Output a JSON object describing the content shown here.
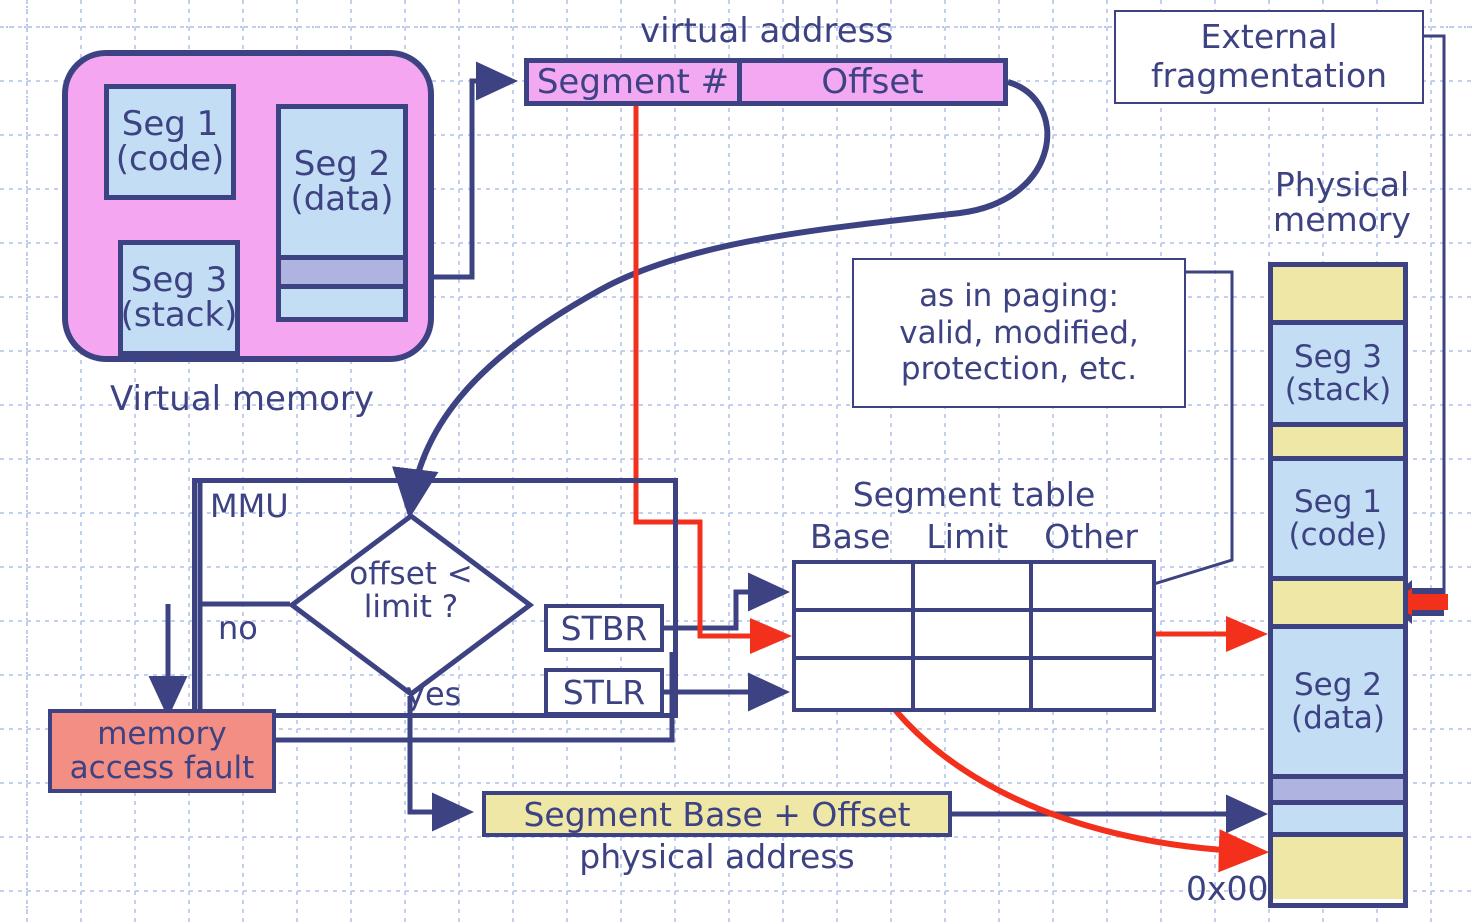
{
  "title": "Segmentation address translation diagram",
  "colors": {
    "ink": "#3d4282",
    "virtual_pod": "#f4a6f0",
    "segment_fill": "#c3ddf5",
    "virtual_address_fill": "#f3a8f2",
    "fault_fill": "#f38e84",
    "physical_address_fill": "#efe7a6",
    "free_hole_fill": "#efe7a6",
    "red_path": "#f3301c",
    "grid": "#c2cfee",
    "band_fill": "#aeb3e0"
  },
  "virtual_memory": {
    "caption": "Virtual memory",
    "segments": [
      {
        "name": "Seg 1",
        "kind": "(code)"
      },
      {
        "name": "Seg 2",
        "kind": "(data)"
      },
      {
        "name": "Seg 3",
        "kind": "(stack)"
      }
    ]
  },
  "virtual_address": {
    "caption": "virtual address",
    "fields": [
      {
        "label": "Segment #"
      },
      {
        "label": "Offset"
      }
    ]
  },
  "callouts": {
    "external_fragmentation": "External\nfragmentation",
    "as_in_paging": "as in paging:\nvalid, modified,\nprotection, etc."
  },
  "mmu": {
    "label": "MMU",
    "decision": "offset <\nlimit ?",
    "branch_no": "no",
    "branch_yes": "yes",
    "registers": [
      {
        "label": "STBR"
      },
      {
        "label": "STLR"
      }
    ]
  },
  "fault": {
    "label": "memory\naccess fault"
  },
  "physical_address": {
    "box_label": "Segment Base + Offset",
    "caption": "physical address"
  },
  "segment_table": {
    "title": "Segment table",
    "columns": [
      "Base",
      "Limit",
      "Other"
    ],
    "rows": [
      [
        "",
        "",
        ""
      ],
      [
        "",
        "",
        ""
      ],
      [
        "",
        "",
        ""
      ]
    ]
  },
  "physical_memory": {
    "caption": "Physical\nmemory",
    "base_label": "0x00",
    "blocks": [
      {
        "type": "hole",
        "label": "",
        "sub": ""
      },
      {
        "type": "segment",
        "label": "Seg 3",
        "sub": "(stack)"
      },
      {
        "type": "hole",
        "label": "",
        "sub": ""
      },
      {
        "type": "segment",
        "label": "Seg 1",
        "sub": "(code)"
      },
      {
        "type": "hole",
        "label": "",
        "sub": ""
      },
      {
        "type": "segment",
        "label": "Seg 2",
        "sub": "(data)"
      },
      {
        "type": "band",
        "label": "",
        "sub": ""
      },
      {
        "type": "segment",
        "label": "",
        "sub": ""
      },
      {
        "type": "hole",
        "label": "",
        "sub": ""
      }
    ]
  }
}
